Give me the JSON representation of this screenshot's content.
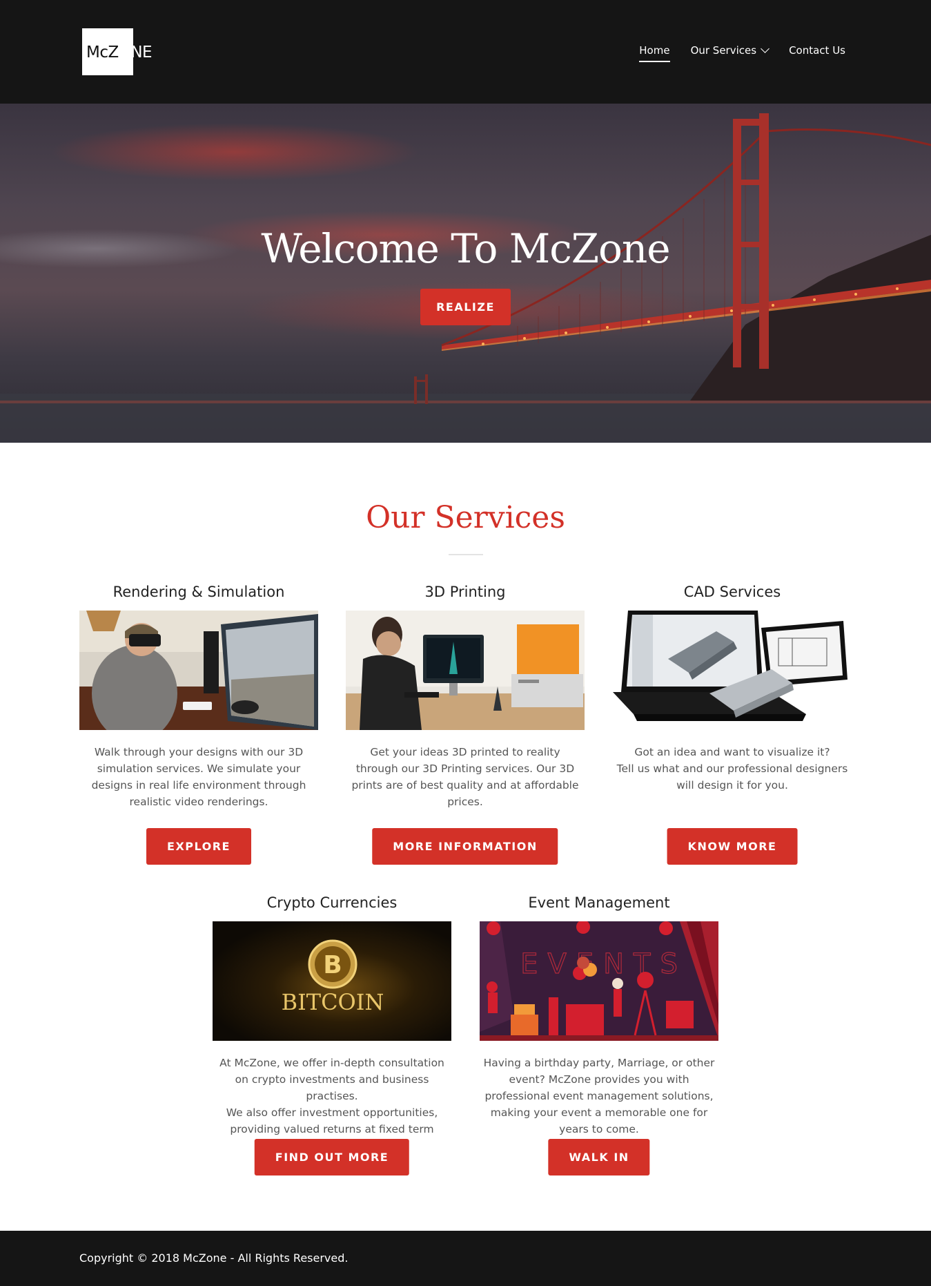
{
  "header": {
    "logo_text_dark": "McZ",
    "logo_text_light": "ONE",
    "nav": [
      {
        "label": "Home"
      },
      {
        "label": "Our Services"
      },
      {
        "label": "Contact Us"
      }
    ]
  },
  "hero": {
    "title": "Welcome To McZone",
    "button": "REALIZE"
  },
  "services": {
    "title": "Our Services",
    "cards": [
      {
        "title": "Rendering & Simulation",
        "description": "Walk through your designs with our 3D simulation services. We simulate your designs in real life environment through realistic video renderings.",
        "button": "EXPLORE"
      },
      {
        "title": "3D Printing",
        "description": "Get your ideas 3D printed  to reality through our 3D Printing services. Our 3D prints are of best quality and  at affordable prices.",
        "button": "MORE INFORMATION"
      },
      {
        "title": "CAD Services",
        "description": "Got an idea and want to visualize it?\nTell us what and our professional designers will design it for you.",
        "button": "KNOW MORE"
      },
      {
        "title": "Crypto Currencies",
        "description": "At McZone, we offer in-depth consultation on crypto investments and business practises.\nWe also offer investment opportunities, providing valued returns at fixed term period.",
        "button": "FIND OUT MORE",
        "image_text": "BITCOIN"
      },
      {
        "title": "Event Management",
        "description": "Having a birthday party, Marriage, or other event? McZone provides you with professional event management solutions, making your event a memorable one for years to come.",
        "button": "WALK IN",
        "image_text": "EVENTS"
      }
    ]
  },
  "footer": {
    "copyright": "Copyright © 2018 McZone - All Rights Reserved."
  },
  "colors": {
    "accent": "#d33128",
    "header_bg": "#151515"
  }
}
